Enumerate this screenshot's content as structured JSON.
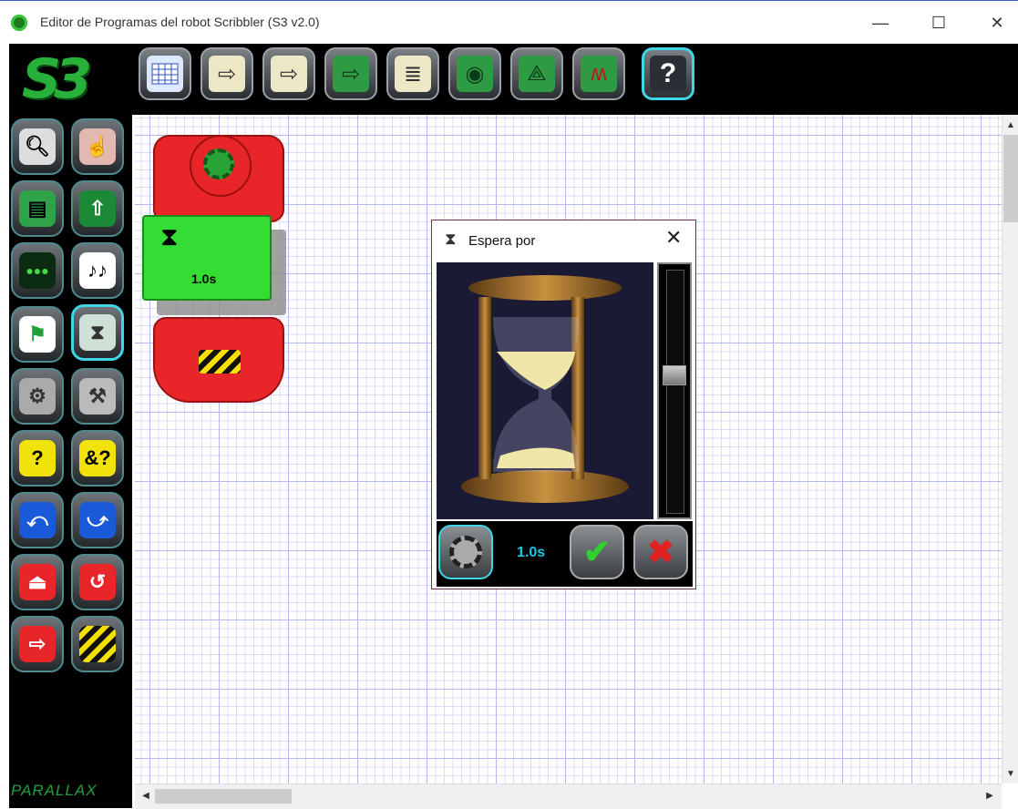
{
  "window": {
    "title": "Editor de Programas del robot Scribbler (S3 v2.0)",
    "minimize_glyph": "—",
    "maximize_glyph": "☐",
    "close_glyph": "✕"
  },
  "logo": {
    "text": "S3"
  },
  "brand": {
    "text": "PARALLAX"
  },
  "toolbar": {
    "buttons": [
      {
        "icon": "calendar-grid-icon"
      },
      {
        "icon": "arrow-into-box-icon"
      },
      {
        "icon": "arrow-into-folder-icon"
      },
      {
        "icon": "arrow-into-robot-icon"
      },
      {
        "icon": "arrow-into-document-icon"
      },
      {
        "icon": "robot-halo-icon"
      },
      {
        "icon": "robot-compass-icon"
      },
      {
        "icon": "robot-signal-icon"
      },
      {
        "icon": "help-icon",
        "label": "?"
      }
    ]
  },
  "palette": {
    "buttons": [
      {
        "icon": "magnifier-icon"
      },
      {
        "icon": "hand-pointer-icon"
      },
      {
        "icon": "clipboard-paste-icon"
      },
      {
        "icon": "robot-upload-icon"
      },
      {
        "icon": "leds-icon"
      },
      {
        "icon": "music-notes-icon"
      },
      {
        "icon": "flag-move-icon"
      },
      {
        "icon": "hourglass-icon"
      },
      {
        "icon": "motor-flow-icon"
      },
      {
        "icon": "sensor-read-icon"
      },
      {
        "icon": "condition-icon",
        "label": "?"
      },
      {
        "icon": "and-condition-icon",
        "label": "&?"
      },
      {
        "icon": "loop-start-icon"
      },
      {
        "icon": "loop-end-icon"
      },
      {
        "icon": "subroutine-icon"
      },
      {
        "icon": "return-icon"
      },
      {
        "icon": "goto-icon"
      },
      {
        "icon": "stop-icon"
      }
    ]
  },
  "program": {
    "wait_block": {
      "value": "1.0s"
    }
  },
  "dialog": {
    "title": "Espera por",
    "close_glyph": "✕",
    "value": "1.0s",
    "slider_level": 0.43,
    "ok_glyph": "✔",
    "cancel_glyph": "✖"
  }
}
